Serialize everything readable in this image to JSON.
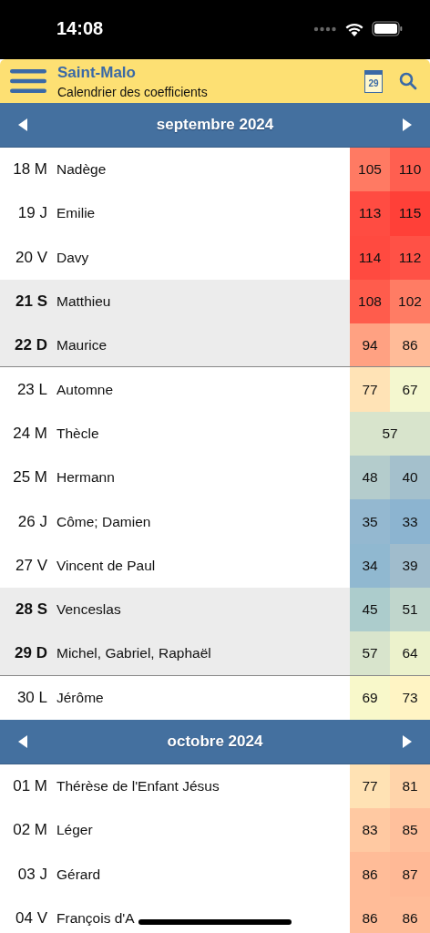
{
  "status_bar": {
    "time": "14:08"
  },
  "header": {
    "title": "Saint-Malo",
    "subtitle": "Calendrier des coefficients",
    "calendar_day": "29"
  },
  "months": [
    {
      "label": "septembre 2024",
      "days": [
        {
          "date": "18 M",
          "name": "Nadège",
          "weekend": false,
          "divider_below": false,
          "coefficients": [
            {
              "value": "105",
              "color": "#ff7a63"
            },
            {
              "value": "110",
              "color": "#ff5f50"
            }
          ]
        },
        {
          "date": "19 J",
          "name": "Emilie",
          "weekend": false,
          "divider_below": false,
          "coefficients": [
            {
              "value": "113",
              "color": "#ff4c42"
            },
            {
              "value": "115",
              "color": "#ff4038"
            }
          ]
        },
        {
          "date": "20 V",
          "name": "Davy",
          "weekend": false,
          "divider_below": false,
          "coefficients": [
            {
              "value": "114",
              "color": "#ff4a40"
            },
            {
              "value": "112",
              "color": "#ff5146"
            }
          ]
        },
        {
          "date": "21 S",
          "name": "Matthieu",
          "weekend": true,
          "divider_below": false,
          "coefficients": [
            {
              "value": "108",
              "color": "#ff5c4c"
            },
            {
              "value": "102",
              "color": "#ff7c64"
            }
          ]
        },
        {
          "date": "22 D",
          "name": "Maurice",
          "weekend": true,
          "divider_below": true,
          "coefficients": [
            {
              "value": "94",
              "color": "#ffa182"
            },
            {
              "value": "86",
              "color": "#ffbb98"
            }
          ]
        },
        {
          "date": "23 L",
          "name": "Automne",
          "weekend": false,
          "divider_below": false,
          "coefficients": [
            {
              "value": "77",
              "color": "#ffe3b6"
            },
            {
              "value": "67",
              "color": "#f4f7cf"
            }
          ]
        },
        {
          "date": "24 M",
          "name": "Thècle",
          "weekend": false,
          "divider_below": false,
          "coefficients": [
            {
              "value": "57",
              "color": "#d8e4cc"
            }
          ]
        },
        {
          "date": "25 M",
          "name": "Hermann",
          "weekend": false,
          "divider_below": false,
          "coefficients": [
            {
              "value": "48",
              "color": "#b4cccc"
            },
            {
              "value": "40",
              "color": "#a4c0cc"
            }
          ]
        },
        {
          "date": "26 J",
          "name": "Côme; Damien",
          "weekend": false,
          "divider_below": false,
          "coefficients": [
            {
              "value": "35",
              "color": "#94b8d0"
            },
            {
              "value": "33",
              "color": "#8cb4d0"
            }
          ]
        },
        {
          "date": "27 V",
          "name": "Vincent de Paul",
          "weekend": false,
          "divider_below": false,
          "coefficients": [
            {
              "value": "34",
              "color": "#90b8d0"
            },
            {
              "value": "39",
              "color": "#a0bccc"
            }
          ]
        },
        {
          "date": "28 S",
          "name": "Venceslas",
          "weekend": true,
          "divider_below": false,
          "coefficients": [
            {
              "value": "45",
              "color": "#accccc"
            },
            {
              "value": "51",
              "color": "#c0d6cc"
            }
          ]
        },
        {
          "date": "29 D",
          "name": "Michel, Gabriel, Raphaël",
          "weekend": true,
          "divider_below": true,
          "coefficients": [
            {
              "value": "57",
              "color": "#d8e4cc"
            },
            {
              "value": "64",
              "color": "#ecf2cc"
            }
          ]
        },
        {
          "date": "30 L",
          "name": "Jérôme",
          "weekend": false,
          "divider_below": false,
          "coefficients": [
            {
              "value": "69",
              "color": "#f8f8ca"
            },
            {
              "value": "73",
              "color": "#fff4c4"
            }
          ]
        }
      ]
    },
    {
      "label": "octobre 2024",
      "days": [
        {
          "date": "01 M",
          "name": "Thérèse de l'Enfant Jésus",
          "weekend": false,
          "divider_below": false,
          "coefficients": [
            {
              "value": "77",
              "color": "#ffe2b4"
            },
            {
              "value": "81",
              "color": "#ffd4aa"
            }
          ]
        },
        {
          "date": "02 M",
          "name": "Léger",
          "weekend": false,
          "divider_below": false,
          "coefficients": [
            {
              "value": "83",
              "color": "#ffc9a2"
            },
            {
              "value": "85",
              "color": "#ffc09c"
            }
          ]
        },
        {
          "date": "03 J",
          "name": "Gérard",
          "weekend": false,
          "divider_below": false,
          "coefficients": [
            {
              "value": "86",
              "color": "#ffbc98"
            },
            {
              "value": "87",
              "color": "#ffb996"
            }
          ]
        },
        {
          "date": "04 V",
          "name": "François d'A",
          "weekend": false,
          "divider_below": false,
          "coefficients": [
            {
              "value": "86",
              "color": "#ffbc98"
            },
            {
              "value": "86",
              "color": "#ffbc98"
            }
          ]
        }
      ]
    }
  ]
}
